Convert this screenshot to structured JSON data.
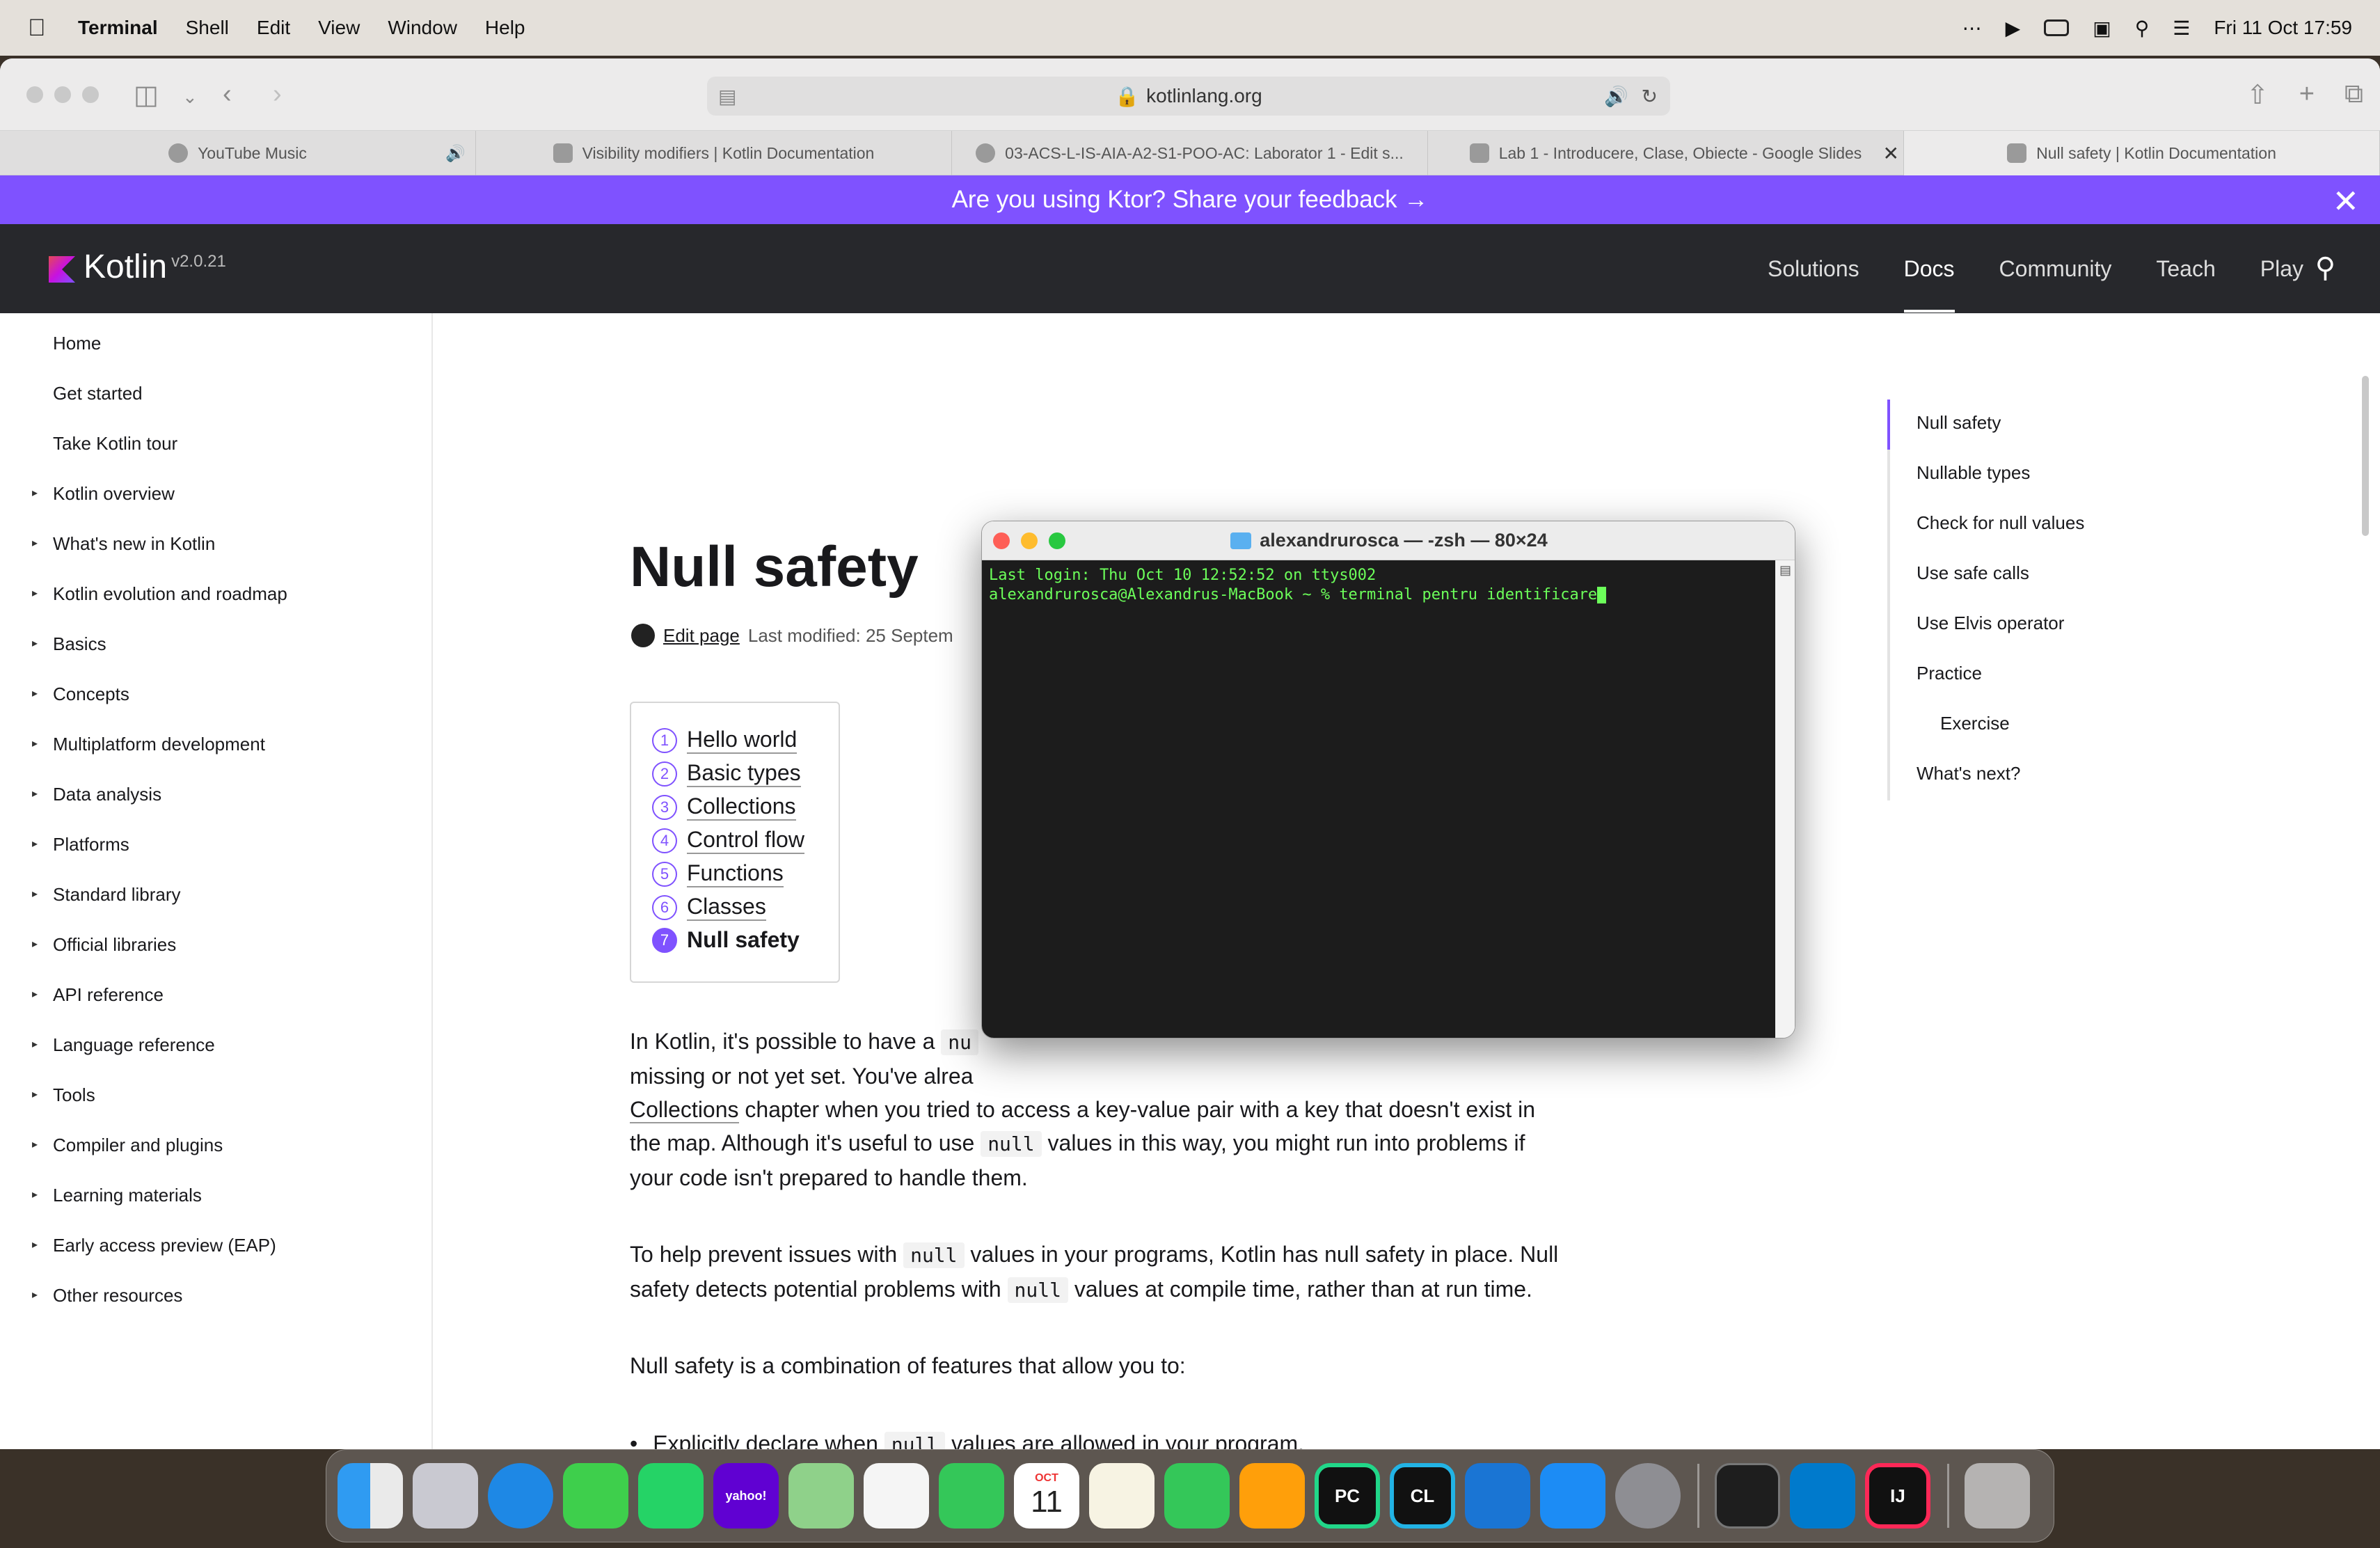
{
  "menubar": {
    "app": "Terminal",
    "items": [
      "Shell",
      "Edit",
      "View",
      "Window",
      "Help"
    ],
    "datetime": "Fri 11 Oct  17:59"
  },
  "safari": {
    "url": "kotlinlang.org",
    "tabs": [
      {
        "label": "YouTube Music"
      },
      {
        "label": "Visibility modifiers | Kotlin Documentation"
      },
      {
        "label": "03-ACS-L-IS-AIA-A2-S1-POO-AC: Laborator 1 - Edit s..."
      },
      {
        "label": "Lab 1 - Introducere, Clase, Obiecte - Google Slides"
      },
      {
        "label": "Null safety | Kotlin Documentation"
      }
    ]
  },
  "banner": {
    "text": "Are you using Ktor? Share your feedback →"
  },
  "header": {
    "logo": "Kotlin",
    "version": "v2.0.21",
    "nav": [
      "Solutions",
      "Docs",
      "Community",
      "Teach",
      "Play"
    ]
  },
  "sidebar": {
    "items": [
      "Home",
      "Get started",
      "Take Kotlin tour",
      "Kotlin overview",
      "What's new in Kotlin",
      "Kotlin evolution and roadmap",
      "Basics",
      "Concepts",
      "Multiplatform development",
      "Data analysis",
      "Platforms",
      "Standard library",
      "Official libraries",
      "API reference",
      "Language reference",
      "Tools",
      "Compiler and plugins",
      "Learning materials",
      "Early access preview (EAP)",
      "Other resources"
    ]
  },
  "article": {
    "title": "Null safety",
    "edit_page": "Edit page",
    "last_modified": "Last modified: 25 Septem",
    "tour": [
      {
        "num": "1",
        "label": "Hello world"
      },
      {
        "num": "2",
        "label": "Basic types"
      },
      {
        "num": "3",
        "label": "Collections"
      },
      {
        "num": "4",
        "label": "Control flow"
      },
      {
        "num": "5",
        "label": "Functions"
      },
      {
        "num": "6",
        "label": "Classes"
      },
      {
        "num": "7",
        "label": "Null safety"
      }
    ],
    "p1a": "In Kotlin, it's possible to have a ",
    "p1b": "missing or not yet set. You've alrea",
    "p1_link": "Collections",
    "p1c": " chapter when you tried to access a key-value pair with a key that doesn't exist in",
    "p1d": "the map. Although it's useful to use ",
    "p1e": " values in this way, you might run into problems if",
    "p1f": "your code isn't prepared to handle them.",
    "p2a": "To help prevent issues with ",
    "p2b": " values in your programs, Kotlin has null safety in place. Null",
    "p2c": "safety detects potential problems with ",
    "p2d": " values at compile time, rather than at run time.",
    "p3": "Null safety is a combination of features that allow you to:",
    "bullet1a": "Explicitly declare when ",
    "bullet1b": " values are allowed in your program.",
    "code_null": "null",
    "code_nu": "nu"
  },
  "toc": {
    "items": [
      "Null safety",
      "Nullable types",
      "Check for null values",
      "Use safe calls",
      "Use Elvis operator",
      "Practice",
      "Exercise",
      "What's next?"
    ]
  },
  "terminal": {
    "title": "alexandrurosca — -zsh — 80×24",
    "line1": "Last login: Thu Oct 10 12:52:52 on ttys002",
    "line2": "alexandrurosca@Alexandrus-MacBook ~ % terminal pentru identificare"
  },
  "dock": {
    "apps": [
      "Finder",
      "Launchpad",
      "Safari",
      "Messages",
      "WhatsApp",
      "Yahoo Mail",
      "Maps",
      "Photos",
      "FaceTime",
      "Calendar",
      "Notes",
      "Numbers",
      "Pages",
      "PyCharm",
      "CLion",
      "Xcode",
      "App Store",
      "System Settings",
      "Terminal",
      "VS Code",
      "IntelliJ IDEA",
      "Trash"
    ],
    "calendar_month": "OCT",
    "calendar_day": "11",
    "yahoo_label": "yahoo!",
    "pc_label": "PC",
    "cl_label": "CL",
    "ij_label": "IJ"
  }
}
